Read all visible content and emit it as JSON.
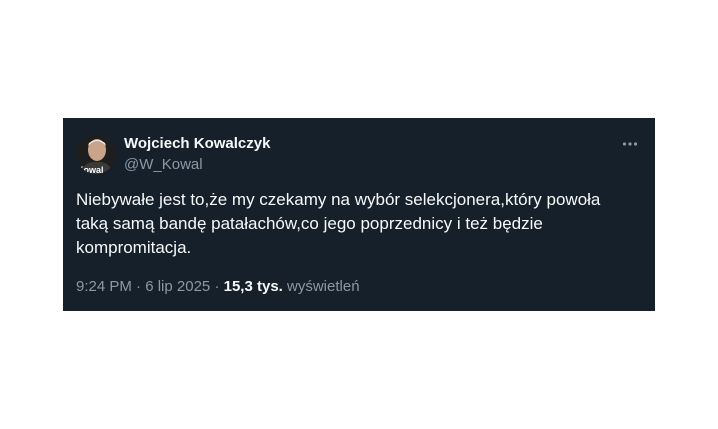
{
  "author": {
    "display_name": "Wojciech Kowalczyk",
    "handle": "@W_Kowal",
    "avatar_text": "Kowal"
  },
  "menu": {
    "more_icon": "more-horizontal-icon"
  },
  "tweet": {
    "text": "Niebywałe jest to,że my czekamy na wybór selekcjonera,który powoła\ntaką samą bandę patałachów,co jego poprzednicy i też będzie\nkompromitacja."
  },
  "meta": {
    "time": "9:24 PM",
    "separator1": " · ",
    "date": "6 lip 2025",
    "separator2": " · ",
    "views_count": "15,3 tys.",
    "views_label": "wyświetleń"
  },
  "colors": {
    "card_background": "#15202b",
    "primary_text": "#f7f9f9",
    "secondary_text": "#8b98a5"
  }
}
